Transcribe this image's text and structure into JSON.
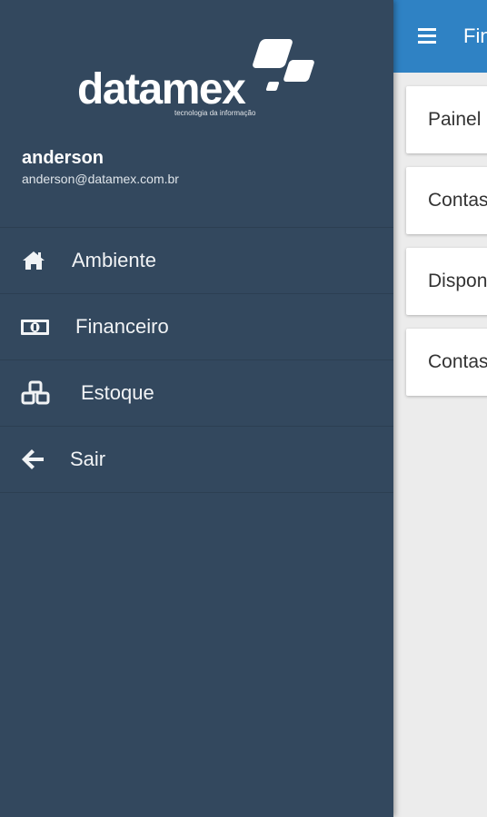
{
  "appbar": {
    "title": "Financeiro",
    "menu_icon": "hamburger-menu-icon",
    "color": "#2f82c4"
  },
  "cards": [
    {
      "label": "Painel"
    },
    {
      "label": "Contas a Pagar"
    },
    {
      "label": "Disponível"
    },
    {
      "label": "Contas a Receber"
    }
  ],
  "drawer": {
    "background": "#33485e",
    "logo": {
      "wordmark": "datamex",
      "tagline": "tecnologia da informação"
    },
    "user": {
      "name": "anderson",
      "email": "anderson@datamex.com.br"
    },
    "nav": [
      {
        "label": "Ambiente",
        "icon": "home-icon"
      },
      {
        "label": "Financeiro",
        "icon": "money-icon"
      },
      {
        "label": "Estoque",
        "icon": "cubes-icon"
      },
      {
        "label": "Sair",
        "icon": "arrow-left-icon"
      }
    ]
  }
}
